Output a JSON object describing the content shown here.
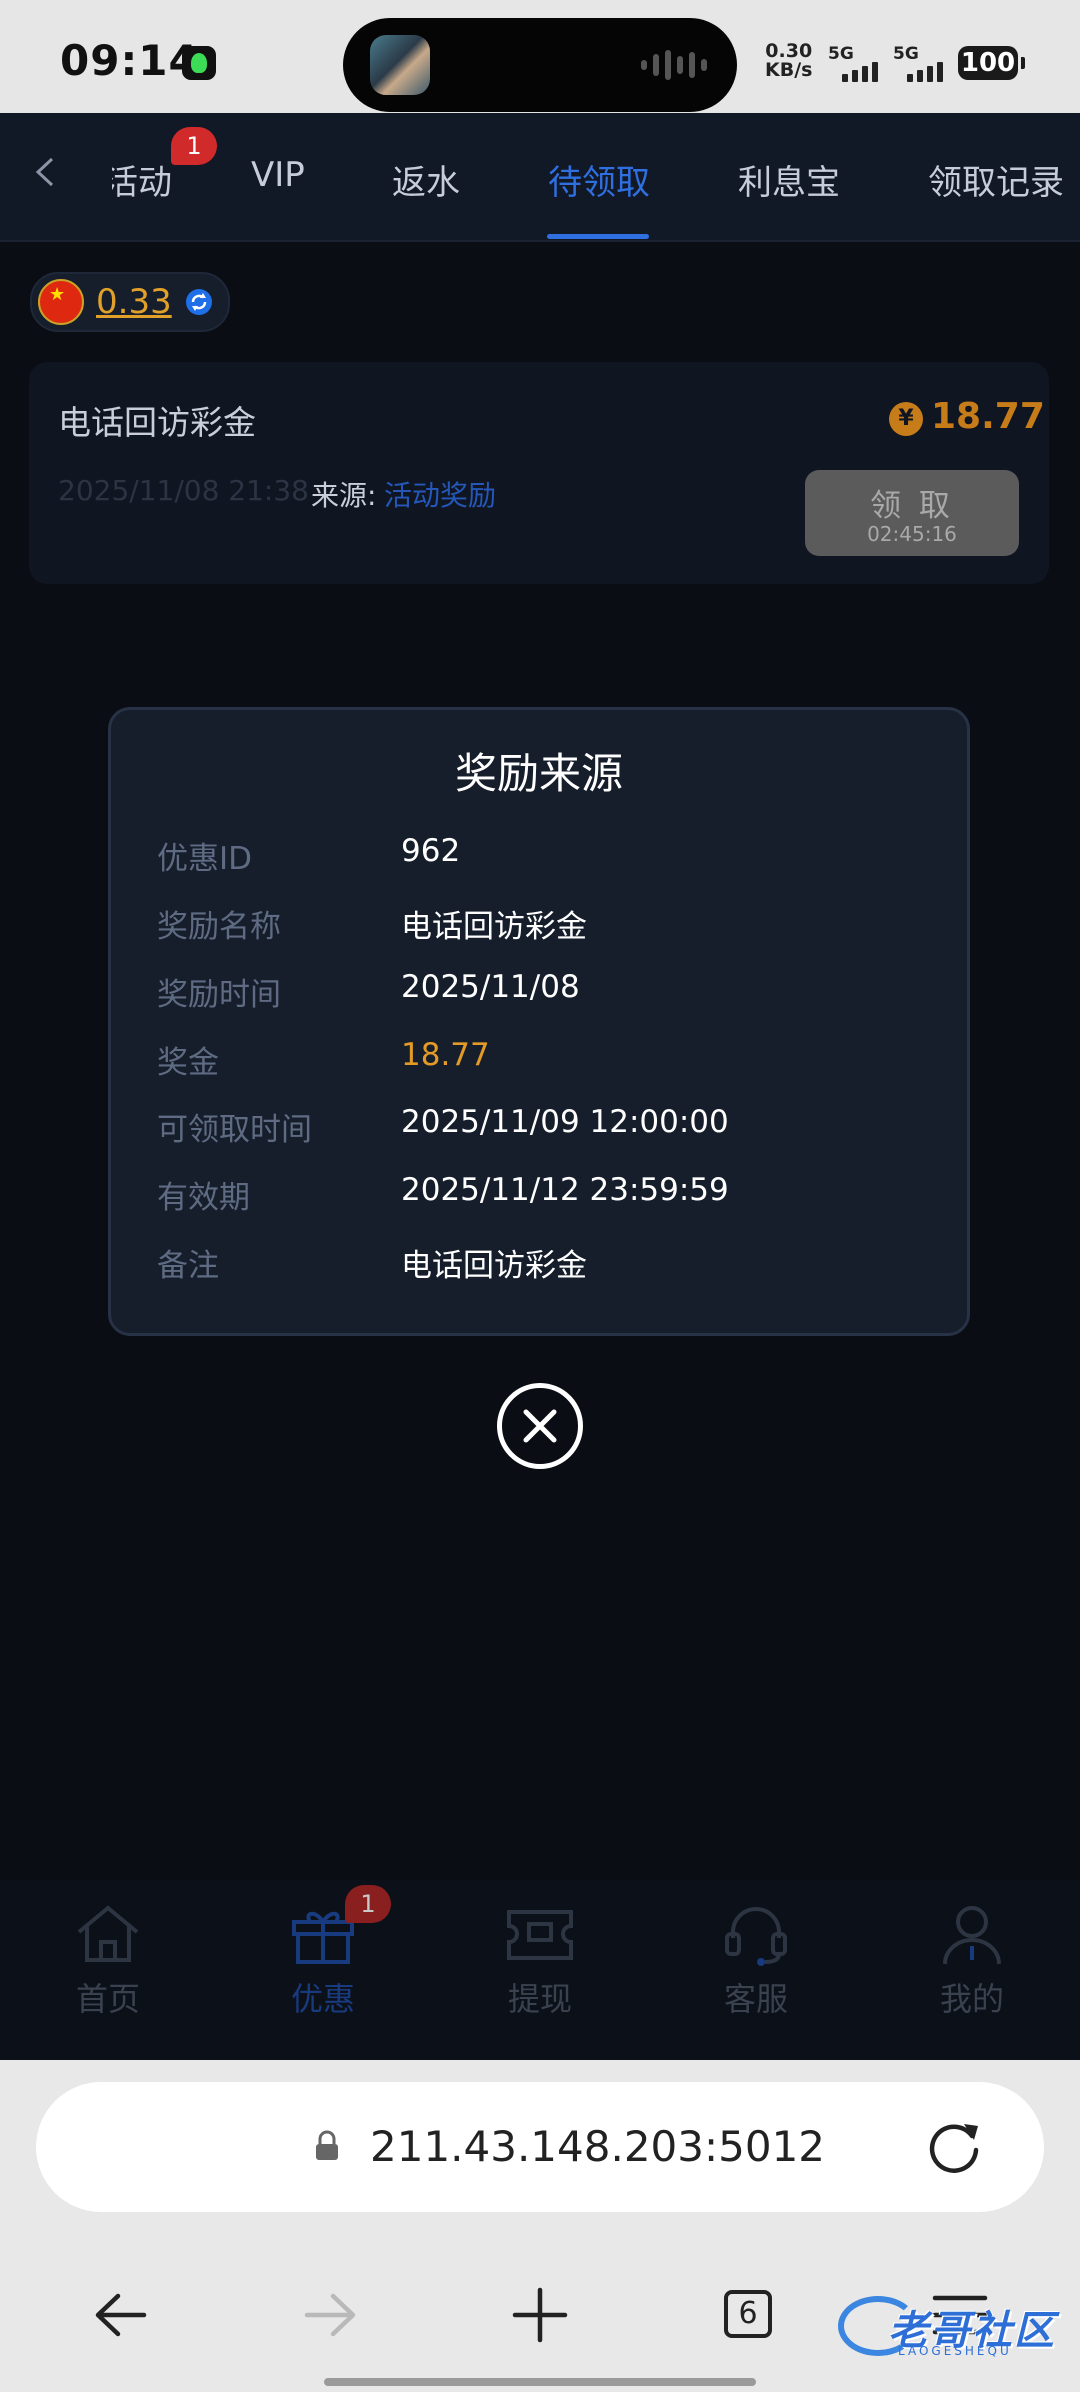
{
  "status_bar": {
    "time": "09:14",
    "net_speed_value": "0.30",
    "net_speed_unit": "KB/s",
    "sim1": "5G",
    "sim2": "5G",
    "battery": "100"
  },
  "tabs": [
    {
      "label": "活动",
      "visible_label": "舌动",
      "badge": "1"
    },
    {
      "label": "VIP"
    },
    {
      "label": "返水"
    },
    {
      "label": "待领取",
      "active": true
    },
    {
      "label": "利息宝"
    },
    {
      "label": "领取记录"
    }
  ],
  "balance": {
    "value": "0.33",
    "currency_flag": "china-flag-icon"
  },
  "reward_card": {
    "title": "电话回访彩金",
    "amount": "18.77",
    "currency_symbol": "¥",
    "datetime": "2025/11/08 21:38",
    "source_label": "来源:",
    "source_link": "活动奖励",
    "claim_label": "领 取",
    "claim_countdown": "02:45:16"
  },
  "modal": {
    "title": "奖励来源",
    "rows": [
      {
        "label": "优惠ID",
        "value": "962"
      },
      {
        "label": "奖励名称",
        "value": "电话回访彩金"
      },
      {
        "label": "奖励时间",
        "value": "2025/11/08"
      },
      {
        "label": "奖金",
        "value": "18.77",
        "highlight": "#e39b26"
      },
      {
        "label": "可领取时间",
        "value": "2025/11/09 12:00:00"
      },
      {
        "label": "有效期",
        "value": "2025/11/12 23:59:59"
      },
      {
        "label": "备注",
        "value": "电话回访彩金"
      }
    ]
  },
  "bottom_nav": [
    {
      "label": "首页",
      "icon": "home-icon"
    },
    {
      "label": "优惠",
      "icon": "gift-icon",
      "active": true,
      "badge": "1"
    },
    {
      "label": "提现",
      "icon": "ticket-icon"
    },
    {
      "label": "客服",
      "icon": "headset-icon"
    },
    {
      "label": "我的",
      "icon": "user-icon"
    }
  ],
  "browser": {
    "url": "211.43.148.203:5012",
    "tab_count": "6"
  },
  "watermark": {
    "text": "老哥社区",
    "sub": "LAOGESHEQU"
  },
  "colors": {
    "accent": "#2f6fe0",
    "gold": "#e39b26",
    "badge_red": "#d02a2a",
    "modal_bg": "#161e2c"
  }
}
